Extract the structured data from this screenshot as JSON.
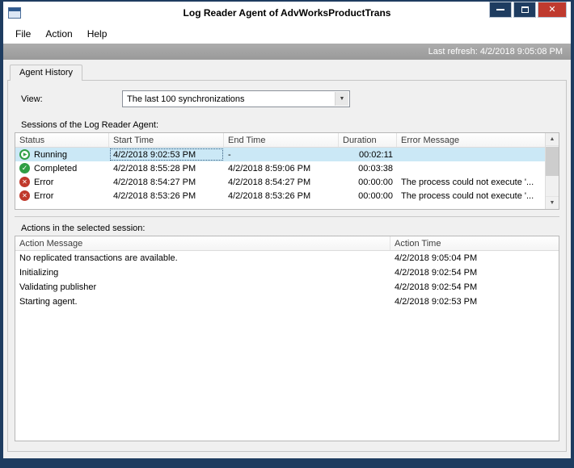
{
  "window": {
    "title": "Log Reader Agent of AdvWorksProductTrans",
    "last_refresh": "Last refresh: 4/2/2018 9:05:08 PM"
  },
  "menu": {
    "items": [
      {
        "label": "File"
      },
      {
        "label": "Action"
      },
      {
        "label": "Help"
      }
    ]
  },
  "tab": {
    "label": "Agent History"
  },
  "view": {
    "label": "View:",
    "value": "The last 100 synchronizations"
  },
  "sessions": {
    "label": "Sessions of the Log Reader Agent:",
    "columns": {
      "status": "Status",
      "start": "Start Time",
      "end": "End Time",
      "duration": "Duration",
      "error": "Error Message"
    },
    "rows": [
      {
        "icon": "running",
        "status": "Running",
        "start": "4/2/2018 9:02:53 PM",
        "end": "-",
        "duration": "00:02:11",
        "error": ""
      },
      {
        "icon": "completed",
        "status": "Completed",
        "start": "4/2/2018 8:55:28 PM",
        "end": "4/2/2018 8:59:06 PM",
        "duration": "00:03:38",
        "error": ""
      },
      {
        "icon": "error",
        "status": "Error",
        "start": "4/2/2018 8:54:27 PM",
        "end": "4/2/2018 8:54:27 PM",
        "duration": "00:00:00",
        "error": "The process could not execute '..."
      },
      {
        "icon": "error",
        "status": "Error",
        "start": "4/2/2018 8:53:26 PM",
        "end": "4/2/2018 8:53:26 PM",
        "duration": "00:00:00",
        "error": "The process could not execute '..."
      }
    ]
  },
  "actions": {
    "label": "Actions in the selected session:",
    "columns": {
      "message": "Action Message",
      "time": "Action Time"
    },
    "rows": [
      {
        "message": "No replicated transactions are available.",
        "time": "4/2/2018 9:05:04 PM"
      },
      {
        "message": "Initializing",
        "time": "4/2/2018 9:02:54 PM"
      },
      {
        "message": "Validating publisher",
        "time": "4/2/2018 9:02:54 PM"
      },
      {
        "message": "Starting agent.",
        "time": "4/2/2018 9:02:53 PM"
      }
    ]
  },
  "icons": {
    "dropdown": "▼",
    "scroll_up": "▲",
    "scroll_down": "▼"
  },
  "colors": {
    "frame": "#1e3c60",
    "close_button": "#bf3a2f",
    "selection": "#cbe8f6",
    "running_green": "#2f9e44",
    "error_red": "#c0392b"
  }
}
